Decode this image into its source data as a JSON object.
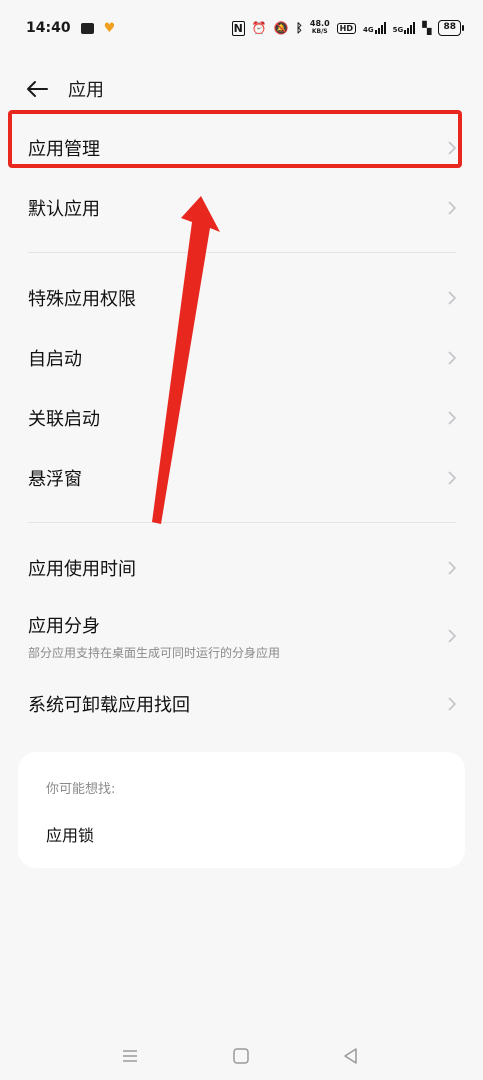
{
  "status_bar": {
    "time": "14:40",
    "net_speed_value": "48.0",
    "net_speed_unit": "KB/S",
    "hd_label": "HD",
    "sim1_label": "4G",
    "sim2_label": "5G",
    "battery": "88"
  },
  "header": {
    "title": "应用"
  },
  "list": {
    "app_management": "应用管理",
    "default_apps": "默认应用",
    "special_permissions": "特殊应用权限",
    "auto_start": "自启动",
    "associated_start": "关联启动",
    "floating_window": "悬浮窗",
    "app_usage_time": "应用使用时间",
    "app_clone": "应用分身",
    "app_clone_desc": "部分应用支持在桌面生成可同时运行的分身应用",
    "recover_system_apps": "系统可卸载应用找回"
  },
  "suggestions": {
    "title": "你可能想找:",
    "items": [
      "应用锁"
    ]
  },
  "colors": {
    "highlight": "#e8281f",
    "background": "#f7f7f8",
    "card": "#ffffff"
  },
  "icons": {
    "back": "back-arrow-icon",
    "chevron": "chevron-right-icon",
    "nav_menu": "menu-icon",
    "nav_home": "home-icon",
    "nav_back": "back-triangle-icon"
  }
}
